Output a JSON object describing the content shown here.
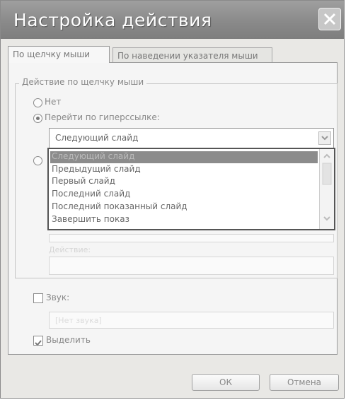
{
  "window": {
    "title": "Настройка действия"
  },
  "tabs": [
    {
      "label": "По щелчку мыши",
      "active": true
    },
    {
      "label": "По наведении указателя мыши",
      "active": false
    }
  ],
  "group": {
    "label": "Действие по щелчку мыши"
  },
  "options": {
    "none": "Нет",
    "hyperlink": "Перейти по гиперссылке:"
  },
  "hyperlink_select": {
    "value": "Следующий слайд",
    "list": [
      "Следующий слайд",
      "Предыдущий слайд",
      "Первый слайд",
      "Последний слайд",
      "Последний показанный слайд",
      "Завершить показ"
    ],
    "selected_index": 0
  },
  "hidden_label": "Действие:",
  "sound": {
    "label": "Звук:",
    "checked": false,
    "value": "[Нет звука]"
  },
  "highlight": {
    "label": "Выделить",
    "checked": true
  },
  "buttons": {
    "ok": "ОК",
    "cancel": "Отмена"
  }
}
